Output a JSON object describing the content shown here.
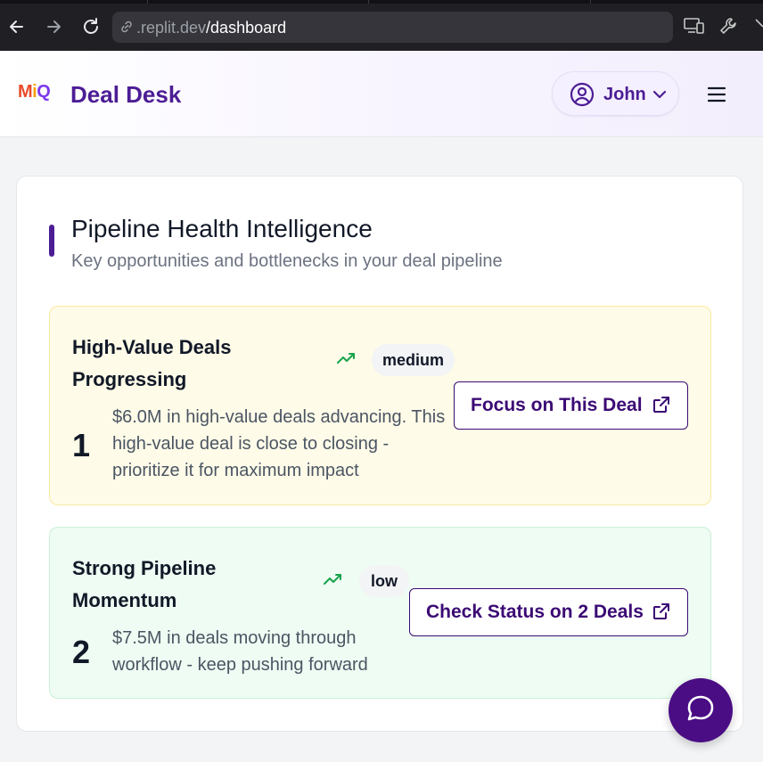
{
  "browser": {
    "url_prefix": ".replit.dev",
    "url_path": "/dashboard"
  },
  "header": {
    "logo_m": "M",
    "logo_i": "i",
    "logo_q": "Q",
    "brand": "Deal Desk",
    "user_name": "John"
  },
  "card": {
    "title": "Pipeline Health Intelligence",
    "subtitle": "Key opportunities and bottlenecks in your deal pipeline",
    "insights": [
      {
        "title": "High-Value Deals Progressing",
        "severity": "medium",
        "count": "1",
        "description": "$6.0M in high-value deals advancing. This high-value deal is close to closing - prioritize it for maximum impact",
        "action": "Focus on This Deal"
      },
      {
        "title": "Strong Pipeline Momentum",
        "severity": "low",
        "count": "2",
        "description": "$7.5M in deals moving through workflow - keep pushing forward",
        "action": "Check Status on 2 Deals"
      }
    ]
  },
  "colors": {
    "brand": "#4c1d95",
    "medium_bg": "#fefbe8",
    "low_bg": "#eefcf3",
    "trend_green": "#16a34a"
  },
  "icons": [
    "back-icon",
    "forward-icon",
    "reload-icon",
    "link-icon",
    "devices-icon",
    "wrench-icon",
    "user-circle-icon",
    "chevron-down-icon",
    "hamburger-menu-icon",
    "trending-up-icon",
    "external-link-icon",
    "chat-bubble-icon"
  ]
}
